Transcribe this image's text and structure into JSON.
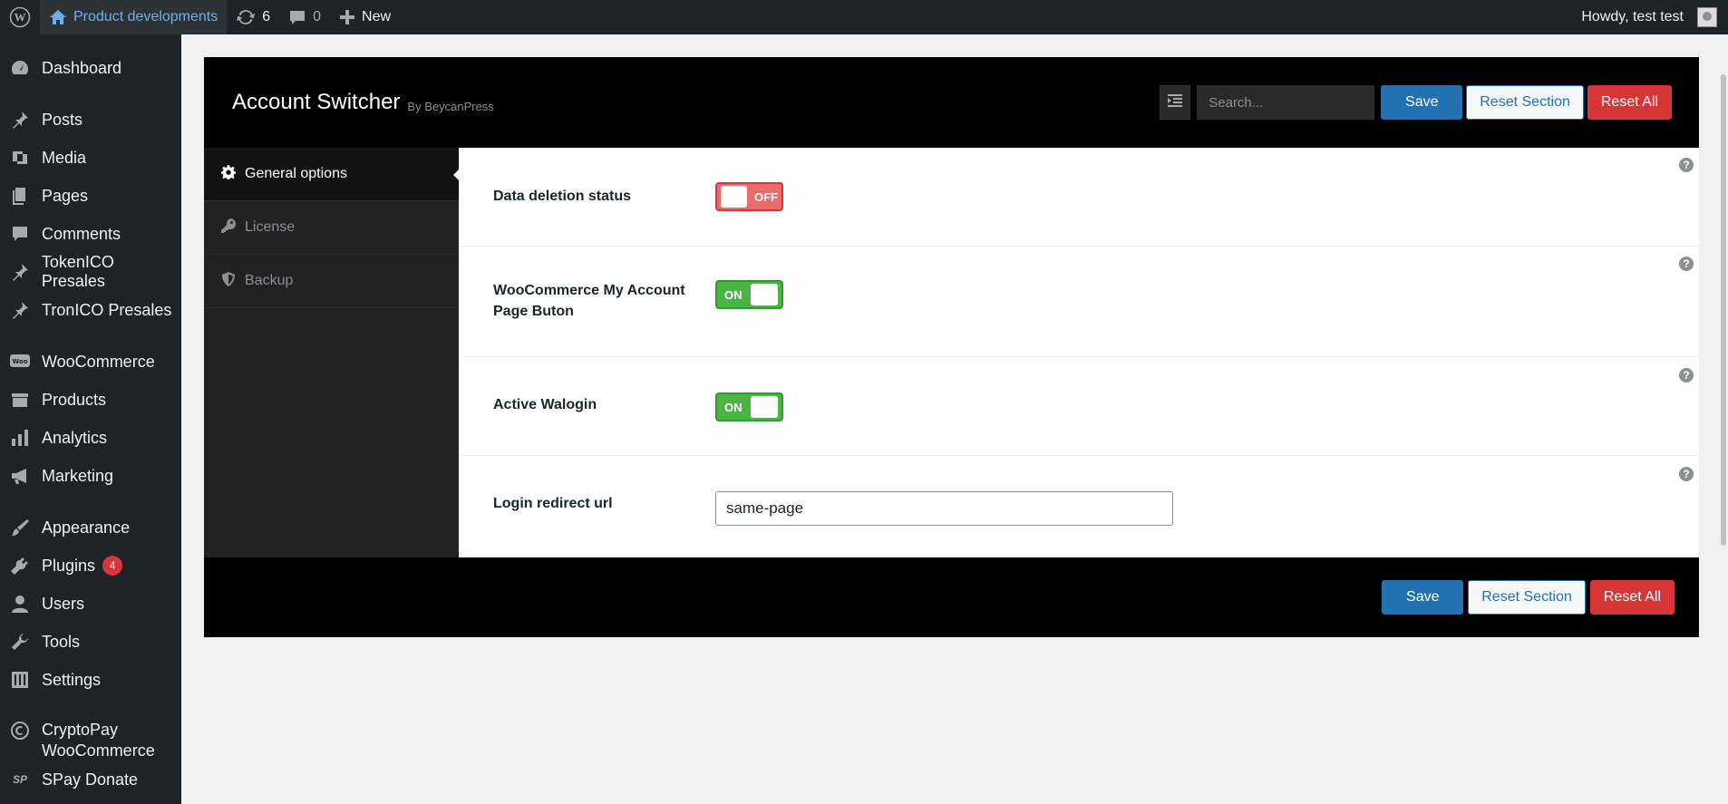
{
  "admin_bar": {
    "site_name": "Product developments",
    "updates_count": "6",
    "comments_count": "0",
    "new_label": "New",
    "howdy": "Howdy, test test"
  },
  "sidebar": {
    "items": [
      {
        "label": "Dashboard",
        "icon": "dashboard-icon"
      },
      {
        "label": "Posts",
        "icon": "pin-icon"
      },
      {
        "label": "Media",
        "icon": "media-icon"
      },
      {
        "label": "Pages",
        "icon": "pages-icon"
      },
      {
        "label": "Comments",
        "icon": "comment-icon"
      },
      {
        "label": "TokenICO Presales",
        "icon": "pin-icon"
      },
      {
        "label": "TronICO Presales",
        "icon": "pin-icon"
      },
      {
        "label": "WooCommerce",
        "icon": "woo-icon"
      },
      {
        "label": "Products",
        "icon": "archive-icon"
      },
      {
        "label": "Analytics",
        "icon": "bar-chart-icon"
      },
      {
        "label": "Marketing",
        "icon": "megaphone-icon"
      },
      {
        "label": "Appearance",
        "icon": "paintbrush-icon"
      },
      {
        "label": "Plugins",
        "icon": "plug-icon",
        "badge": "4"
      },
      {
        "label": "Users",
        "icon": "user-icon"
      },
      {
        "label": "Tools",
        "icon": "wrench-icon"
      },
      {
        "label": "Settings",
        "icon": "sliders-icon"
      },
      {
        "label_line1": "CryptoPay",
        "label_line2": "WooCommerce",
        "icon": "cryptopay-icon"
      },
      {
        "label": "SPay Donate",
        "icon": "sp-icon",
        "icon_text": "SP"
      }
    ]
  },
  "panel": {
    "title": "Account Switcher",
    "by": "By BeycanPress",
    "search_placeholder": "Search...",
    "save_label": "Save",
    "reset_section_label": "Reset Section",
    "reset_all_label": "Reset All",
    "nav": [
      {
        "label": "General options",
        "icon": "gear-icon",
        "active": true
      },
      {
        "label": "License",
        "icon": "key-icon",
        "active": false
      },
      {
        "label": "Backup",
        "icon": "shield-icon",
        "active": false
      }
    ],
    "fields": [
      {
        "label": "Data deletion status",
        "type": "toggle",
        "state": "OFF"
      },
      {
        "label": "WooCommerce My Account Page Buton",
        "type": "toggle",
        "state": "ON"
      },
      {
        "label": "Active Walogin",
        "type": "toggle",
        "state": "ON"
      },
      {
        "label": "Login redirect url",
        "type": "text",
        "value": "same-page"
      }
    ],
    "help_glyph": "?"
  },
  "colors": {
    "admin_bar_bg": "#1d2327",
    "primary": "#2271b1",
    "danger": "#d63638",
    "toggle_on": "#4bb543",
    "toggle_off": "#e86e6e"
  }
}
